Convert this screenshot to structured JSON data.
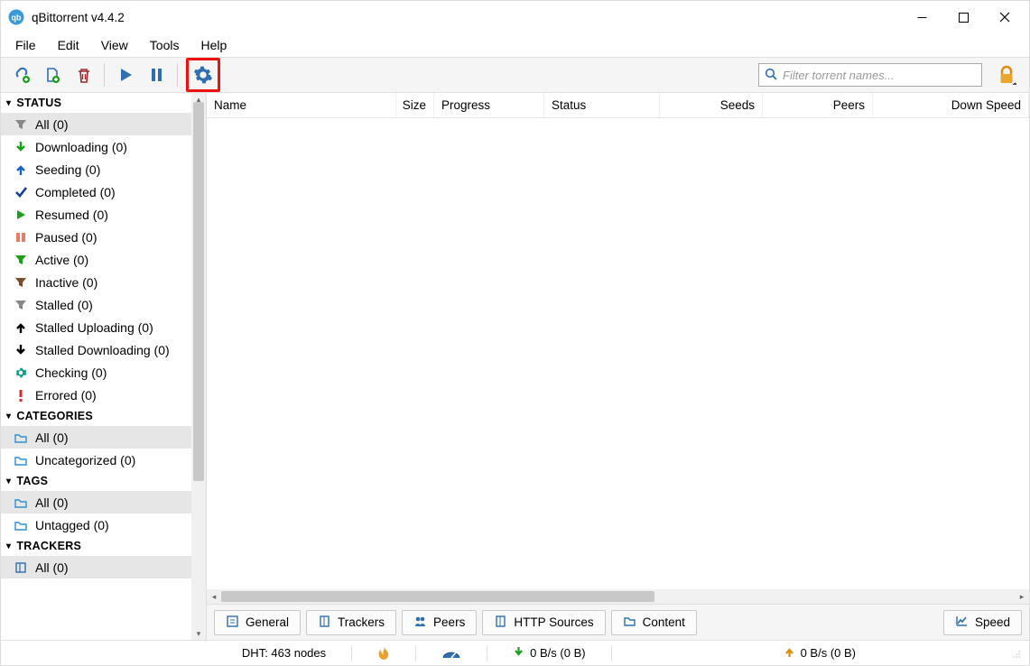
{
  "window": {
    "title": "qBittorrent v4.4.2"
  },
  "menu": {
    "file": "File",
    "edit": "Edit",
    "view": "View",
    "tools": "Tools",
    "help": "Help"
  },
  "toolbar": {
    "search_placeholder": "Filter torrent names..."
  },
  "sidebar": {
    "status_header": "STATUS",
    "status": [
      {
        "label": "All (0)"
      },
      {
        "label": "Downloading (0)"
      },
      {
        "label": "Seeding (0)"
      },
      {
        "label": "Completed (0)"
      },
      {
        "label": "Resumed (0)"
      },
      {
        "label": "Paused (0)"
      },
      {
        "label": "Active (0)"
      },
      {
        "label": "Inactive (0)"
      },
      {
        "label": "Stalled (0)"
      },
      {
        "label": "Stalled Uploading (0)"
      },
      {
        "label": "Stalled Downloading (0)"
      },
      {
        "label": "Checking (0)"
      },
      {
        "label": "Errored (0)"
      }
    ],
    "categories_header": "CATEGORIES",
    "categories": [
      {
        "label": "All (0)"
      },
      {
        "label": "Uncategorized (0)"
      }
    ],
    "tags_header": "TAGS",
    "tags": [
      {
        "label": "All (0)"
      },
      {
        "label": "Untagged (0)"
      }
    ],
    "trackers_header": "TRACKERS",
    "trackers": [
      {
        "label": "All (0)"
      }
    ]
  },
  "columns": {
    "name": "Name",
    "size": "Size",
    "progress": "Progress",
    "status": "Status",
    "seeds": "Seeds",
    "peers": "Peers",
    "down": "Down Speed"
  },
  "tabs": {
    "general": "General",
    "trackers": "Trackers",
    "peers": "Peers",
    "http": "HTTP Sources",
    "content": "Content",
    "speed": "Speed"
  },
  "status_bar": {
    "dht": "DHT: 463 nodes",
    "down": "0 B/s (0 B)",
    "up": "0 B/s (0 B)"
  },
  "colors": {
    "accent": "#2f6fb0",
    "green": "#18a018",
    "orange": "#e08b00",
    "red": "#d9282e"
  }
}
